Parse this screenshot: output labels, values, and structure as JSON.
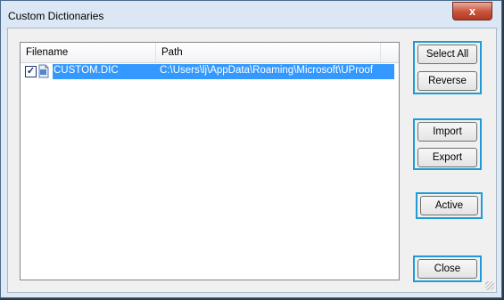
{
  "window": {
    "title": "Custom Dictionaries",
    "close_label": "x"
  },
  "list": {
    "columns": [
      "Filename",
      "Path"
    ],
    "rows": [
      {
        "checked": true,
        "filename": "CUSTOM.DIC",
        "path": "C:\\Users\\lj\\AppData\\Roaming\\Microsoft\\UProof"
      }
    ]
  },
  "buttons": {
    "select_all": "Select All",
    "reverse": "Reverse",
    "import": "Import",
    "export": "Export",
    "active": "Active",
    "close": "Close"
  },
  "colors": {
    "highlight_frame": "#1f9bd7",
    "selection": "#3399ff"
  },
  "icons": [
    "close-icon",
    "checkbox-checked-icon",
    "dictionary-file-icon"
  ]
}
